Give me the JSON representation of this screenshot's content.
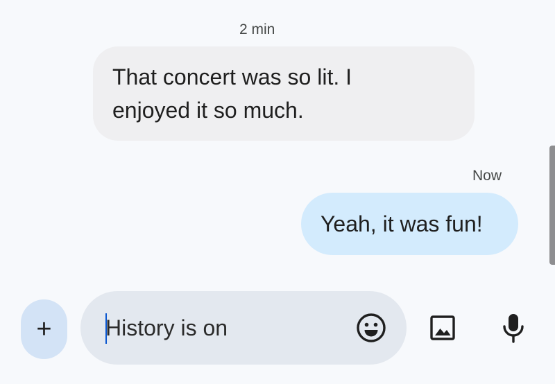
{
  "conversation": {
    "messages": [
      {
        "direction": "incoming",
        "timestamp": "2 min",
        "lines": [
          "That concert was so lit. I",
          "enjoyed it so much."
        ]
      },
      {
        "direction": "outgoing",
        "timestamp": "Now",
        "text": "Yeah, it was fun!"
      }
    ]
  },
  "composer": {
    "plus_label": "+",
    "input_placeholder": "History is on",
    "input_value": "",
    "icons": [
      "plus-icon",
      "emoji-icon",
      "image-icon",
      "microphone-icon"
    ]
  },
  "colors": {
    "background": "#f7f9fc",
    "incoming_bubble": "#efeff1",
    "outgoing_bubble": "#d3ebfd",
    "compose_field": "#e3e8ef",
    "plus_button": "#d3e3f6",
    "caret": "#0b57d0"
  }
}
